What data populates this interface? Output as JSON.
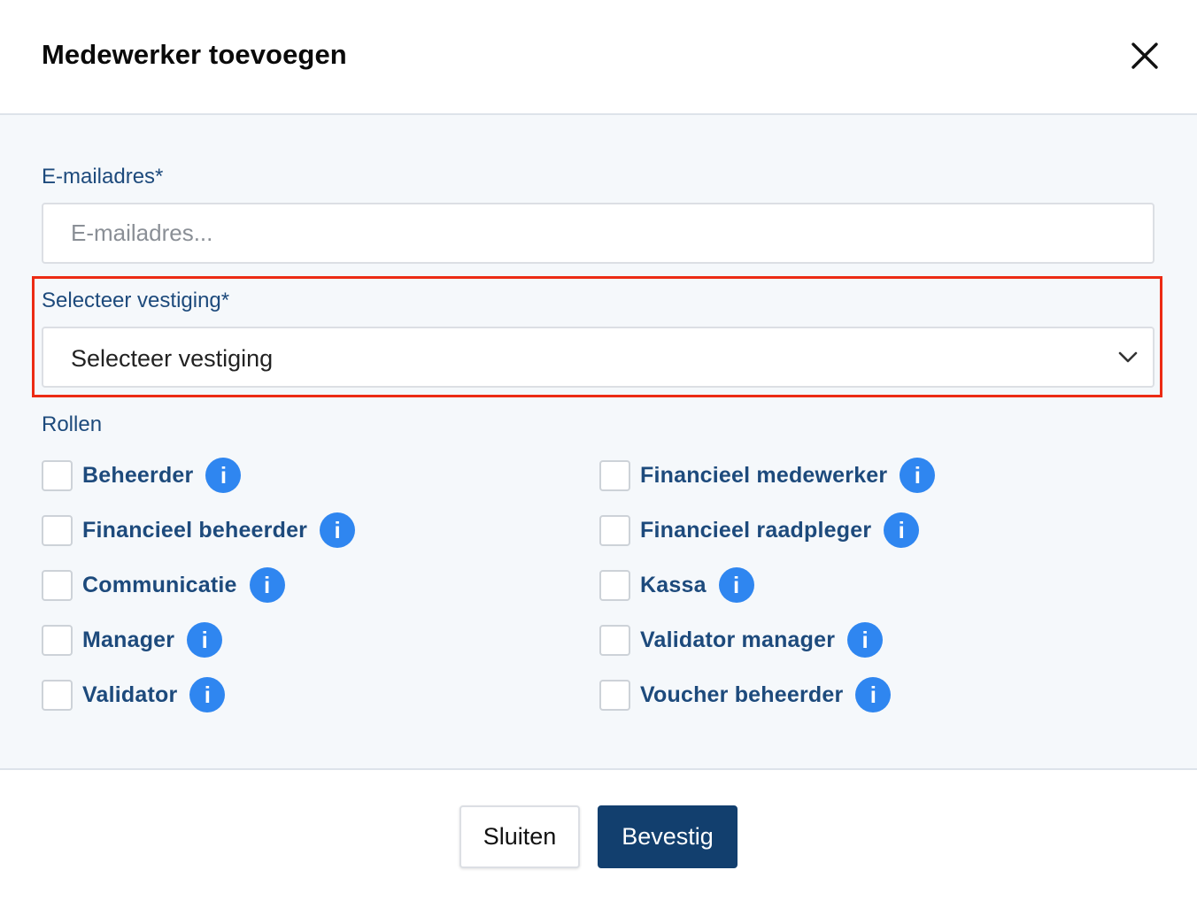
{
  "dialog": {
    "title": "Medewerker toevoegen",
    "close_icon": "close-icon"
  },
  "form": {
    "email_label": "E-mailadres*",
    "email_placeholder": "E-mailadres...",
    "email_value": "",
    "location_label": "Selecteer vestiging*",
    "location_selected": "Selecteer vestiging",
    "roles_label": "Rollen",
    "roles": [
      {
        "label": "Beheerder",
        "checked": false
      },
      {
        "label": "Financieel medewerker",
        "checked": false
      },
      {
        "label": "Financieel beheerder",
        "checked": false
      },
      {
        "label": "Financieel raadpleger",
        "checked": false
      },
      {
        "label": "Communicatie",
        "checked": false
      },
      {
        "label": "Kassa",
        "checked": false
      },
      {
        "label": "Manager",
        "checked": false
      },
      {
        "label": "Validator manager",
        "checked": false
      },
      {
        "label": "Validator",
        "checked": false
      },
      {
        "label": "Voucher beheerder",
        "checked": false
      }
    ],
    "info_icon_glyph": "i"
  },
  "footer": {
    "close_label": "Sluiten",
    "confirm_label": "Bevestig"
  },
  "colors": {
    "accent": "#123f6e",
    "label_text": "#1d4a7c",
    "info_icon": "#2f86f0",
    "highlight": "#ec2b14",
    "body_background": "#f5f8fb"
  }
}
